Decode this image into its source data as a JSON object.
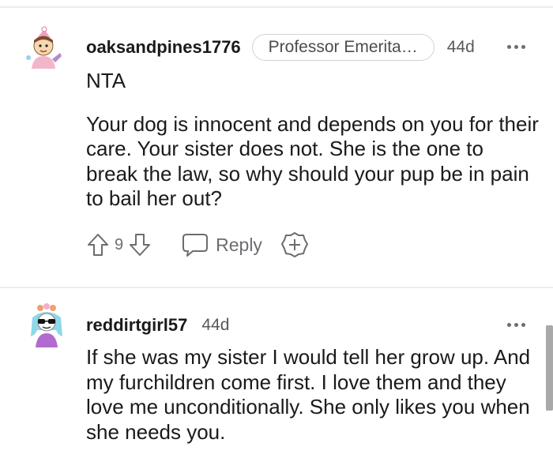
{
  "comments": [
    {
      "username": "oaksandpines1776",
      "flair": "Professor Emerita…",
      "age": "44d",
      "paragraphs": [
        "NTA",
        "Your dog is innocent and depends on you for their care. Your sister does not. She is the one to break the law, so why should your pup be in pain to bail her out?"
      ],
      "votes": "9",
      "reply_label": "Reply"
    },
    {
      "username": "reddirtgirl57",
      "age": "44d",
      "paragraphs": [
        "If she was my sister I would tell her grow up. And my furchildren come first. I love them and they love me unconditionally. She only likes you when she needs you."
      ]
    }
  ],
  "icons": {
    "upvote": "arrow-up-icon",
    "downvote": "arrow-down-icon",
    "reply": "speech-bubble-icon",
    "award": "plus-badge-icon",
    "more": "more-dots-icon"
  },
  "colors": {
    "text": "#1a1a1b",
    "meta": "#6b6d70",
    "divider": "#ececec"
  }
}
